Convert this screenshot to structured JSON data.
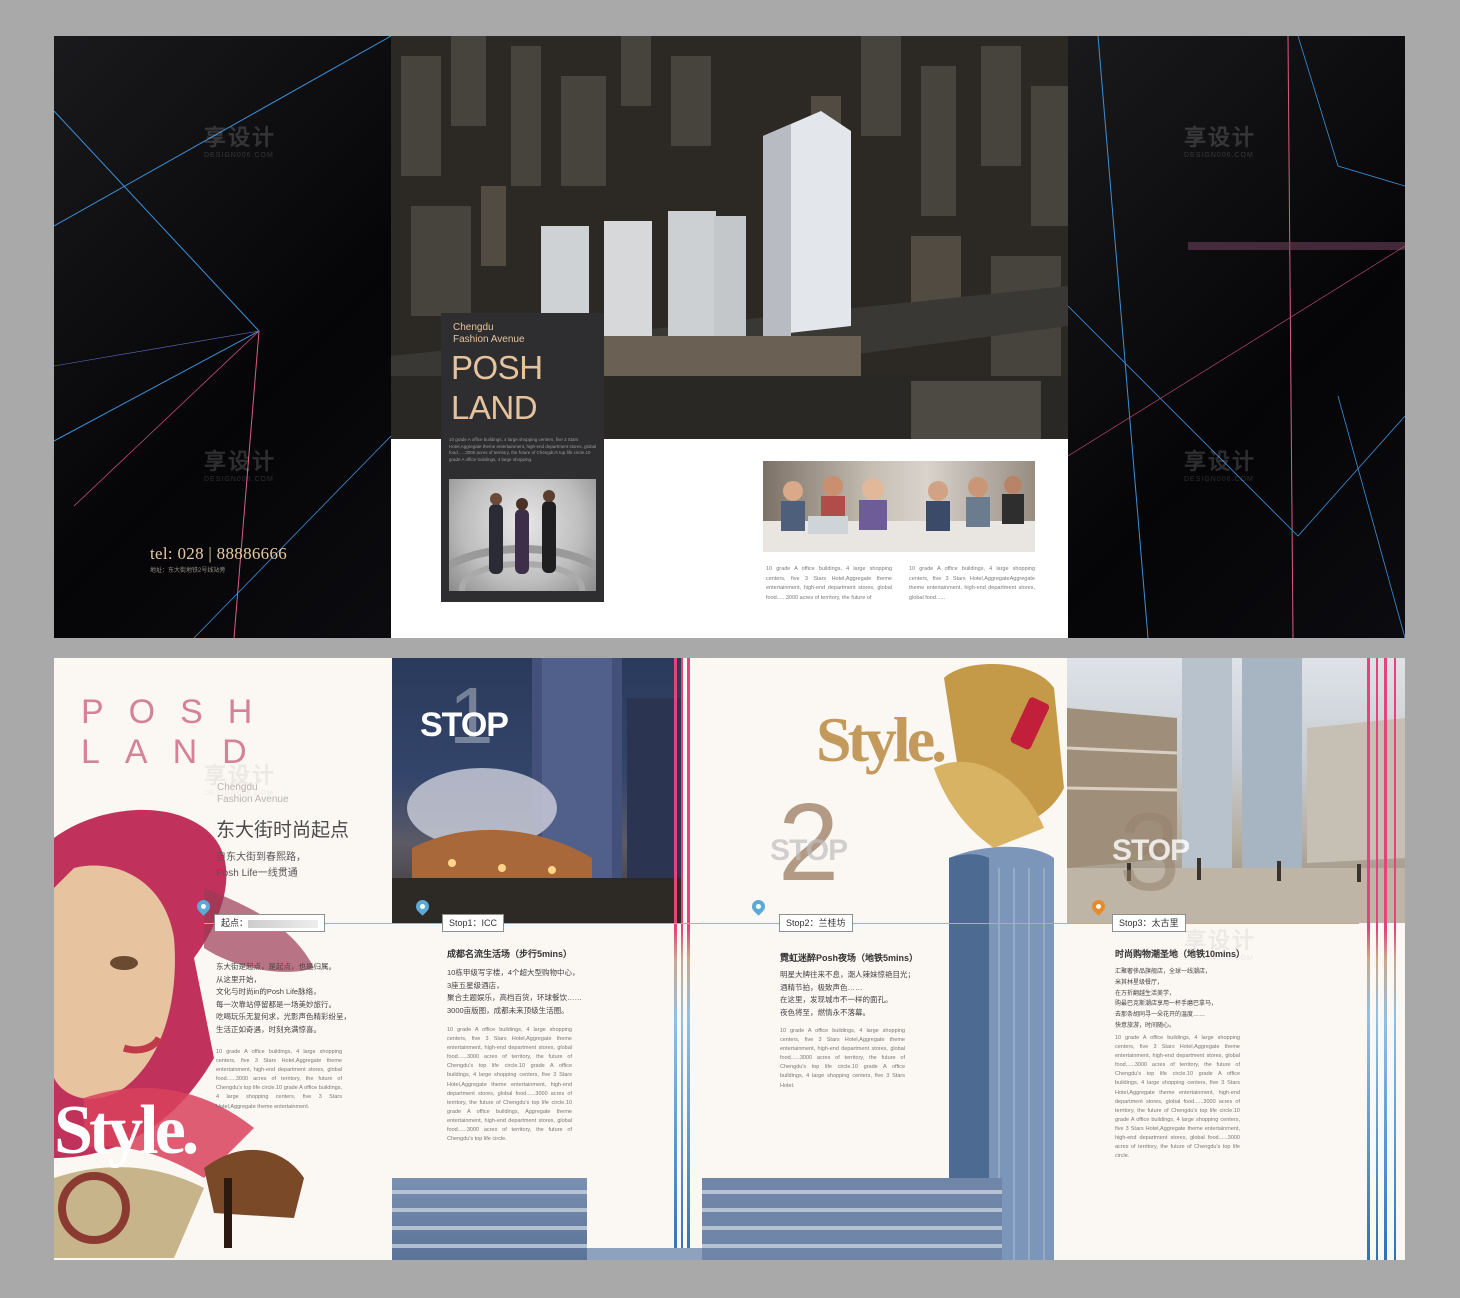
{
  "top": {
    "tel": "tel: 028 | 88886666",
    "address": "地址：东大街地铁2号线站旁",
    "box": {
      "sub1": "Chengdu",
      "sub2": "Fashion Avenue",
      "title1": "POSH",
      "title2": "LAND",
      "text": "10 grade A office buildings, 4 large shopping centers, five 3 Stars Hotel,Aggregate theme entertainment, high-end department stores, global food......3000 acres of territory, the future of Chengdu's top life circle.10 grade A office buildings, 4 large shopping."
    },
    "col1": "10 grade A office buildings, 4 large shopping centers, five 3 Stars Hotel,Aggregate theme entertainment, high-end department stores, global food......3000 acres of territory, the future of",
    "col2": "10 grade A office buildings, 4 large shopping centers, five 3 Stars Hotel,AggregateAggregate theme entertainment, high-end department stores, global food......"
  },
  "watermark": {
    "cn": "享设计",
    "en": "DESIGN006.COM"
  },
  "bottom": {
    "posh": "POSH",
    "land": "LAND",
    "sub1": "Chengdu",
    "sub2": "Fashion Avenue",
    "title": "东大街时尚起点",
    "line1": "自东大街到春熙路，",
    "line2": "Posh Life一线贯通",
    "start_label": "起点：",
    "start_cn": "东大街是起点，是起点，也是归属。\n从这里开始，\n文化与时尚in的Posh Life脉络，\n每一次靠站停留都是一场美妙旅行。\n吃喝玩乐无复何求，光影声色精彩纷呈，\n生活正如奇遇，时刻充满惊喜。",
    "start_en": "10 grade A office buildings, 4 large shopping centers, five 3 Stars Hotel,Aggregate theme entertainment, high-end department stores, global food......3000 acres of territory, the future of Chengdu's top life circle.10 grade A office buildings, 4 large shopping centers, five 3 Stars Hotel,Aggregate theme entertainment.",
    "style_word": "Style.",
    "stop_word": "STOP",
    "stops": [
      {
        "num": "1",
        "label": "Stop1：ICC",
        "heading": "成都名流生活场（步行5mins）",
        "cn": "10栋甲级写字楼，4个超大型购物中心，\n3座五星级酒店，\n聚合主题娱乐，高档百货，环球餐饮……\n3000亩版图，成都未来顶级生活圈。",
        "en": "10 grade A office buildings, 4 large shopping centers, five 3 Stars Hotel,Aggregate theme entertainment, high-end department stores, global food......3000 acres of territory, the future of Chengdu's top life circle.10 grade A office buildings, 4 large shopping centers, five 3 Stars Hotel,Aggregate theme entertainment, high-end department stores, global food......3000 acres of territory, the future of Chengdu's top life circle.10 grade A office buildings, Aggregate theme entertainment, high-end department stores, global food......3000 acres of territory, the future of Chengdu's top life circle."
      },
      {
        "num": "2",
        "label": "Stop2：兰桂坊",
        "heading": "霓虹迷醉Posh夜场（地铁5mins）",
        "cn": "明星大牌往来不息，潮人辣妹惊艳目光；\n酒精节拍，极致声色……\n在这里，发现城市不一样的面孔。\n夜色将至，燃情永不落幕。",
        "en": "10 grade A office buildings, 4 large shopping centers, five 3 Stars Hotel,Aggregate theme entertainment, high-end department stores, global food......3000 acres of territory, the future of Chengdu's top life circle.10 grade A office buildings, 4 large shopping centers, five 3 Stars Hotel."
      },
      {
        "num": "3",
        "label": "Stop3：太古里",
        "heading": "时尚购物潮圣地（地铁10mins）",
        "cn": "汇聚奢侈品旗舰店，全球一线潮店，\n米其林星级餐厅，\n在万折翻越生活美学，\n购最巴克斯潮店享用一杯手磨巴拿马，\n去那条胡同寻一朵花开的温度……\n快意旅游，时间随心。",
        "en": "10 grade A office buildings, 4 large shopping centers, five 3 Stars Hotel,Aggregate theme entertainment, high-end department stores, global food......3000 acres of territory, the future of Chengdu's top life circle.10 grade A office buildings, 4 large shopping centers, five 3 Stars Hotel,Aggregate theme entertainment, high-end department stores, global food......3000 acres of territory, the future of Chengdu's top life circle.10 grade A office buildings, 4 large shopping centers, five 3 Stars Hotel,Aggregate theme entertainment, high-end department stores, global food......3000 acres of territory, the future of Chengdu's top life circle."
      }
    ]
  },
  "colors": {
    "accent_gold": "#e6c39c",
    "accent_pink": "#d4829a",
    "pin_blue": "#5aa9d6",
    "pin_orange": "#e88a2c"
  }
}
